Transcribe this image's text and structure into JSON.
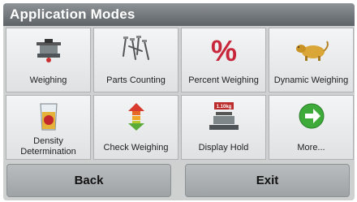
{
  "screen": {
    "title": "Application Modes"
  },
  "tiles": [
    {
      "label": "Weighing",
      "icon": "scale-pan-icon"
    },
    {
      "label": "Parts Counting",
      "icon": "screws-icon"
    },
    {
      "label": "Percent Weighing",
      "icon": "percent-icon"
    },
    {
      "label": "Dynamic Weighing",
      "icon": "animal-icon"
    },
    {
      "label": "Density\nDetermination",
      "icon": "beaker-icon"
    },
    {
      "label": "Check Weighing",
      "icon": "up-down-arrows-icon"
    },
    {
      "label": "Display Hold",
      "icon": "hold-display-icon",
      "display_value": "1.10kg"
    },
    {
      "label": "More...",
      "icon": "green-arrow-icon"
    }
  ],
  "buttons": {
    "back": "Back",
    "exit": "Exit"
  },
  "colors": {
    "title_bar": "#6f7478",
    "percent_red": "#c8263a",
    "arrow_green": "#3daa3a",
    "animal_gold": "#d9a637"
  }
}
